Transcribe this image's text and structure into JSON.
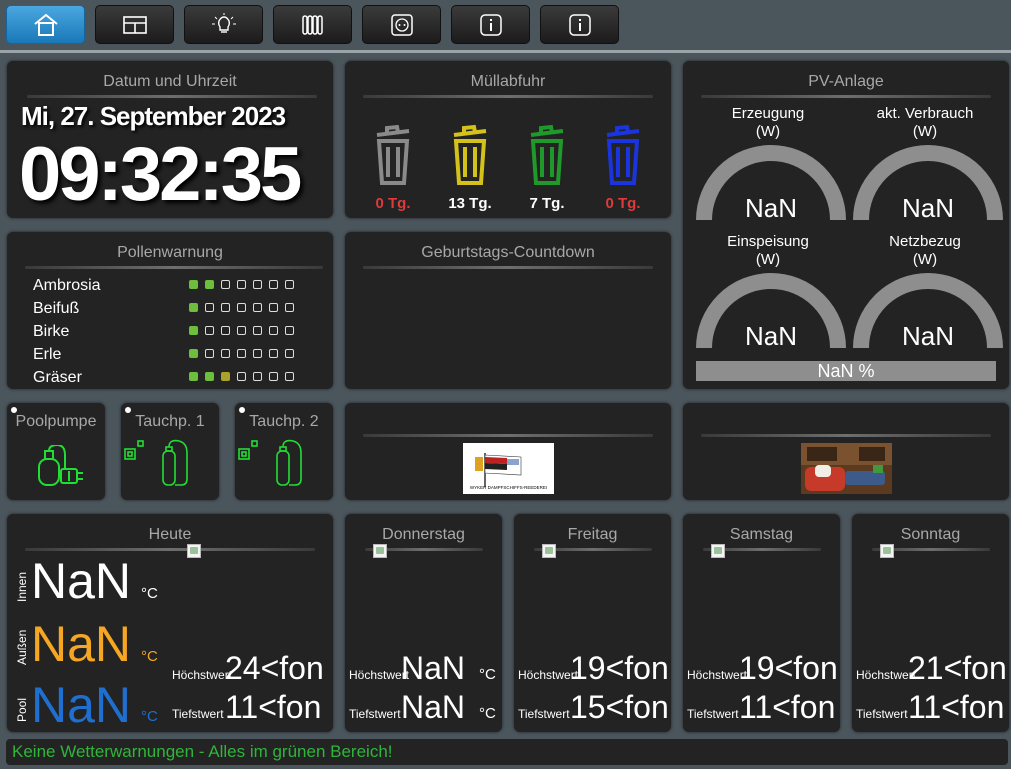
{
  "colors": {
    "accent": "#1a78b8",
    "red": "#e03a3a",
    "green": "#2fb53a",
    "orange": "#f5a623",
    "blue": "#1f6fd0",
    "device_green": "#22dd33"
  },
  "nav": {
    "icons": [
      "home-icon",
      "window-icon",
      "lightbulb-icon",
      "radiator-icon",
      "socket-icon",
      "info-icon",
      "info-icon"
    ]
  },
  "datetime": {
    "title": "Datum und Uhrzeit",
    "date": "Mi, 27. September 2023",
    "time": "09:32:35"
  },
  "waste": {
    "title": "Müllabfuhr",
    "bins": [
      {
        "color": "#8a8a8a",
        "days": "0 Tg.",
        "label_color": "#e03a3a"
      },
      {
        "color": "#d4c21a",
        "days": "13 Tg.",
        "label_color": "#ffffff"
      },
      {
        "color": "#1f9a2a",
        "days": "7 Tg.",
        "label_color": "#ffffff"
      },
      {
        "color": "#1a35e0",
        "days": "0 Tg.",
        "label_color": "#e03a3a"
      }
    ]
  },
  "pv": {
    "title": "PV-Anlage",
    "gauges": [
      {
        "label": "Erzeugung",
        "unit": "(W)",
        "value": "NaN"
      },
      {
        "label": "akt. Verbrauch",
        "unit": "(W)",
        "value": "NaN"
      },
      {
        "label": "Einspeisung",
        "unit": "(W)",
        "value": "NaN"
      },
      {
        "label": "Netzbezug",
        "unit": "(W)",
        "value": "NaN"
      }
    ],
    "bar": "NaN %"
  },
  "pollen": {
    "title": "Pollenwarnung",
    "rows": [
      {
        "name": "Ambrosia",
        "levels": [
          "g",
          "g",
          "o",
          "o",
          "o",
          "o",
          "o"
        ]
      },
      {
        "name": "Beifuß",
        "levels": [
          "g",
          "o",
          "o",
          "o",
          "o",
          "o",
          "o"
        ]
      },
      {
        "name": "Birke",
        "levels": [
          "g",
          "o",
          "o",
          "o",
          "o",
          "o",
          "o"
        ]
      },
      {
        "name": "Erle",
        "levels": [
          "g",
          "o",
          "o",
          "o",
          "o",
          "o",
          "o"
        ]
      },
      {
        "name": "Gräser",
        "levels": [
          "g",
          "g",
          "y",
          "o",
          "o",
          "o",
          "o"
        ]
      }
    ]
  },
  "birthday": {
    "title": "Geburtstags-Countdown"
  },
  "devices": [
    {
      "title": "Poolpumpe"
    },
    {
      "title": "Tauchp. 1"
    },
    {
      "title": "Tauchp. 2"
    }
  ],
  "logo": {
    "text": "WYKER DAMPFSCHIFFS-REEDEREI"
  },
  "weather": {
    "today": {
      "title": "Heute",
      "rows": [
        {
          "label": "Innen",
          "value": "NaN",
          "unit": "°C",
          "color": "#ffffff"
        },
        {
          "label": "Außen",
          "value": "NaN",
          "unit": "°C",
          "color": "#f5a623"
        },
        {
          "label": "Pool",
          "value": "NaN",
          "unit": "°C",
          "color": "#1f6fd0"
        }
      ],
      "high_label": "Höchstwert",
      "high": "24<fon",
      "low_label": "Tiefstwert",
      "low": "11<fon"
    },
    "days": [
      {
        "title": "Donnerstag",
        "high_label": "Höchstwert",
        "high": "NaN",
        "high_unit": "°C",
        "low_label": "Tiefstwert",
        "low": "NaN",
        "low_unit": "°C"
      },
      {
        "title": "Freitag",
        "high_label": "Höchstwert",
        "high": "19<fon",
        "high_unit": "",
        "low_label": "Tiefstwert",
        "low": "15<fon",
        "low_unit": ""
      },
      {
        "title": "Samstag",
        "high_label": "Höchstwert",
        "high": "19<fon",
        "high_unit": "",
        "low_label": "Tiefstwert",
        "low": "11<fon",
        "low_unit": ""
      },
      {
        "title": "Sonntag",
        "high_label": "Höchstwert",
        "high": "21<fon",
        "high_unit": "",
        "low_label": "Tiefstwert",
        "low": "11<fon",
        "low_unit": ""
      }
    ]
  },
  "warning": "Keine Wetterwarnungen - Alles im grünen Bereich!"
}
